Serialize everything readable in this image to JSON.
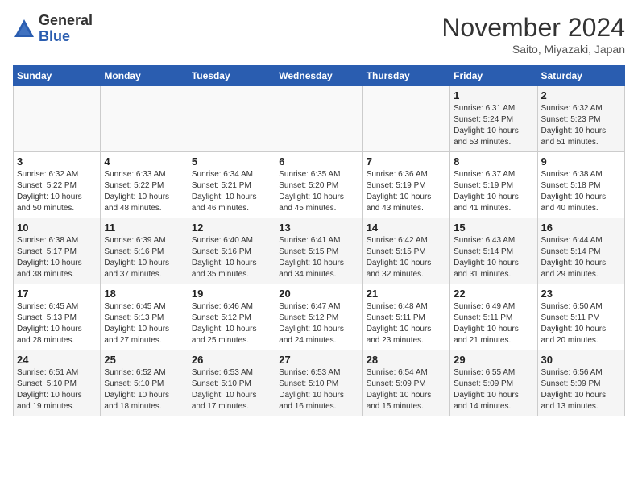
{
  "header": {
    "logo_general": "General",
    "logo_blue": "Blue",
    "month_title": "November 2024",
    "subtitle": "Saito, Miyazaki, Japan"
  },
  "days_of_week": [
    "Sunday",
    "Monday",
    "Tuesday",
    "Wednesday",
    "Thursday",
    "Friday",
    "Saturday"
  ],
  "weeks": [
    [
      {
        "day": "",
        "info": ""
      },
      {
        "day": "",
        "info": ""
      },
      {
        "day": "",
        "info": ""
      },
      {
        "day": "",
        "info": ""
      },
      {
        "day": "",
        "info": ""
      },
      {
        "day": "1",
        "info": "Sunrise: 6:31 AM\nSunset: 5:24 PM\nDaylight: 10 hours and 53 minutes."
      },
      {
        "day": "2",
        "info": "Sunrise: 6:32 AM\nSunset: 5:23 PM\nDaylight: 10 hours and 51 minutes."
      }
    ],
    [
      {
        "day": "3",
        "info": "Sunrise: 6:32 AM\nSunset: 5:22 PM\nDaylight: 10 hours and 50 minutes."
      },
      {
        "day": "4",
        "info": "Sunrise: 6:33 AM\nSunset: 5:22 PM\nDaylight: 10 hours and 48 minutes."
      },
      {
        "day": "5",
        "info": "Sunrise: 6:34 AM\nSunset: 5:21 PM\nDaylight: 10 hours and 46 minutes."
      },
      {
        "day": "6",
        "info": "Sunrise: 6:35 AM\nSunset: 5:20 PM\nDaylight: 10 hours and 45 minutes."
      },
      {
        "day": "7",
        "info": "Sunrise: 6:36 AM\nSunset: 5:19 PM\nDaylight: 10 hours and 43 minutes."
      },
      {
        "day": "8",
        "info": "Sunrise: 6:37 AM\nSunset: 5:19 PM\nDaylight: 10 hours and 41 minutes."
      },
      {
        "day": "9",
        "info": "Sunrise: 6:38 AM\nSunset: 5:18 PM\nDaylight: 10 hours and 40 minutes."
      }
    ],
    [
      {
        "day": "10",
        "info": "Sunrise: 6:38 AM\nSunset: 5:17 PM\nDaylight: 10 hours and 38 minutes."
      },
      {
        "day": "11",
        "info": "Sunrise: 6:39 AM\nSunset: 5:16 PM\nDaylight: 10 hours and 37 minutes."
      },
      {
        "day": "12",
        "info": "Sunrise: 6:40 AM\nSunset: 5:16 PM\nDaylight: 10 hours and 35 minutes."
      },
      {
        "day": "13",
        "info": "Sunrise: 6:41 AM\nSunset: 5:15 PM\nDaylight: 10 hours and 34 minutes."
      },
      {
        "day": "14",
        "info": "Sunrise: 6:42 AM\nSunset: 5:15 PM\nDaylight: 10 hours and 32 minutes."
      },
      {
        "day": "15",
        "info": "Sunrise: 6:43 AM\nSunset: 5:14 PM\nDaylight: 10 hours and 31 minutes."
      },
      {
        "day": "16",
        "info": "Sunrise: 6:44 AM\nSunset: 5:14 PM\nDaylight: 10 hours and 29 minutes."
      }
    ],
    [
      {
        "day": "17",
        "info": "Sunrise: 6:45 AM\nSunset: 5:13 PM\nDaylight: 10 hours and 28 minutes."
      },
      {
        "day": "18",
        "info": "Sunrise: 6:45 AM\nSunset: 5:13 PM\nDaylight: 10 hours and 27 minutes."
      },
      {
        "day": "19",
        "info": "Sunrise: 6:46 AM\nSunset: 5:12 PM\nDaylight: 10 hours and 25 minutes."
      },
      {
        "day": "20",
        "info": "Sunrise: 6:47 AM\nSunset: 5:12 PM\nDaylight: 10 hours and 24 minutes."
      },
      {
        "day": "21",
        "info": "Sunrise: 6:48 AM\nSunset: 5:11 PM\nDaylight: 10 hours and 23 minutes."
      },
      {
        "day": "22",
        "info": "Sunrise: 6:49 AM\nSunset: 5:11 PM\nDaylight: 10 hours and 21 minutes."
      },
      {
        "day": "23",
        "info": "Sunrise: 6:50 AM\nSunset: 5:11 PM\nDaylight: 10 hours and 20 minutes."
      }
    ],
    [
      {
        "day": "24",
        "info": "Sunrise: 6:51 AM\nSunset: 5:10 PM\nDaylight: 10 hours and 19 minutes."
      },
      {
        "day": "25",
        "info": "Sunrise: 6:52 AM\nSunset: 5:10 PM\nDaylight: 10 hours and 18 minutes."
      },
      {
        "day": "26",
        "info": "Sunrise: 6:53 AM\nSunset: 5:10 PM\nDaylight: 10 hours and 17 minutes."
      },
      {
        "day": "27",
        "info": "Sunrise: 6:53 AM\nSunset: 5:10 PM\nDaylight: 10 hours and 16 minutes."
      },
      {
        "day": "28",
        "info": "Sunrise: 6:54 AM\nSunset: 5:09 PM\nDaylight: 10 hours and 15 minutes."
      },
      {
        "day": "29",
        "info": "Sunrise: 6:55 AM\nSunset: 5:09 PM\nDaylight: 10 hours and 14 minutes."
      },
      {
        "day": "30",
        "info": "Sunrise: 6:56 AM\nSunset: 5:09 PM\nDaylight: 10 hours and 13 minutes."
      }
    ]
  ]
}
